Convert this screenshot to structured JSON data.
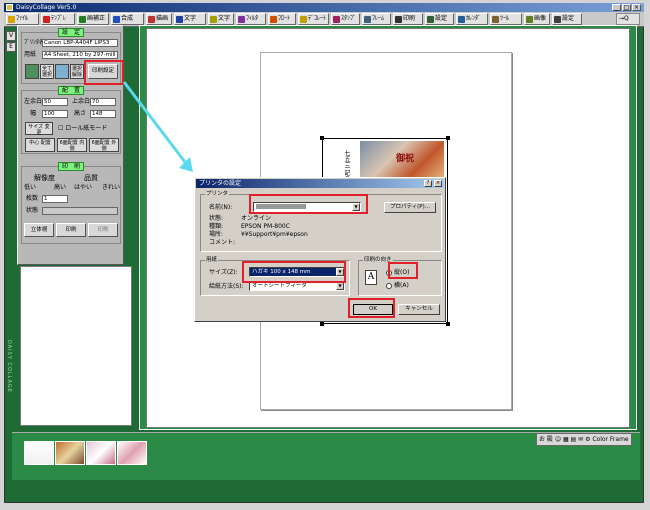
{
  "app": {
    "title": "DaisyCollage  Ver5.0"
  },
  "toolbar": {
    "items": [
      {
        "label": "ﾌｧｲﾙ",
        "icon": "folder-icon",
        "color": "#d9a400"
      },
      {
        "label": "ﾃﾝﾌﾟﾚ",
        "icon": "heart-icon",
        "color": "#d02020"
      },
      {
        "label": "画補正",
        "icon": "brush-icon",
        "color": "#208020"
      },
      {
        "label": "合成",
        "icon": "layers-icon",
        "color": "#2050c0"
      },
      {
        "label": "描画",
        "icon": "pencil-icon",
        "color": "#c03030"
      },
      {
        "label": "文字",
        "icon": "text-icon",
        "color": "#2040a0"
      },
      {
        "label": "文字",
        "icon": "text2-icon",
        "color": "#a0a000"
      },
      {
        "label": "ﾌｨﾙﾀ",
        "icon": "filter-icon",
        "color": "#8030a0"
      },
      {
        "label": "ﾌﾛｰﾄ",
        "icon": "float-icon",
        "color": "#d05000"
      },
      {
        "label": "ﾃﾞｺﾚｰﾄ",
        "icon": "decorate-icon",
        "color": "#c0a000"
      },
      {
        "label": "ｽﾀﾝﾌﾟ",
        "icon": "stamp-icon",
        "color": "#a02060"
      },
      {
        "label": "ﾌﾚｰﾑ",
        "icon": "frame-icon",
        "color": "#406080"
      },
      {
        "label": "印刷",
        "icon": "printer-icon",
        "color": "#303030"
      },
      {
        "label": "設定",
        "icon": "settings-icon",
        "color": "#306030"
      },
      {
        "label": "ｶﾚﾝﾀﾞ",
        "icon": "calendar-icon",
        "color": "#2060a0"
      },
      {
        "label": "ﾂｰﾙ",
        "icon": "tool-icon",
        "color": "#806030"
      },
      {
        "label": "画像",
        "icon": "image-icon",
        "color": "#608020"
      },
      {
        "label": "設定",
        "icon": "gear-icon",
        "color": "#404040"
      }
    ],
    "right_label": "Q"
  },
  "vtabs": [
    "V",
    "E"
  ],
  "panel": {
    "setup_head": "設　定",
    "printer_label": "ﾌﾟﾘﾝﾀ名",
    "printer_value": "Canon LBP-A404F LIPS3",
    "paper_label": "用紙",
    "paper_value": "A4 Sheet, 210 by 297-mill",
    "btn_all": "全て\n選択",
    "btn_cancel": "選択\n解除",
    "btn_print_setup": "印刷設定",
    "layout_head": "配　置",
    "left_margin_label": "左余白",
    "left_margin_value": "50",
    "top_margin_label": "上余白",
    "top_margin_value": "70",
    "width_label": "幅",
    "width_value": "100",
    "height_label": "高さ",
    "height_value": "148",
    "size_change": "サイズ\n変更",
    "roll_mode": "ロール紙モード",
    "center_place": "中心\n配置",
    "six_inside": "6面配置\n内側",
    "six_outside": "6面配置\n外側",
    "print_head": "印　刷",
    "resolution_label": "解像度",
    "quality_label": "品質",
    "res_low": "低い",
    "res_high": "高い",
    "q_fast": "はやい",
    "q_fine": "きれい",
    "copies_label": "枚数",
    "copies_value": "1",
    "status_label": "状態",
    "btn_stereo": "立体視",
    "btn_print": "印刷",
    "btn_other": "印刷"
  },
  "canvas": {
    "vtext": "七五三 記念",
    "photo_text": "御祝"
  },
  "brand": "DAISY COLLAGE",
  "tray": {
    "icons": "お 殿 ☺ ▦ ▤ ✉ ⚙ Color Frame"
  },
  "dialog": {
    "title": "プリンタの設定",
    "help": "?",
    "close": "×",
    "printer_group": "プリンタ",
    "name_label": "名前(N):",
    "name_value": "",
    "properties_btn": "プロパティ(P)...",
    "status_label": "状態:",
    "status_value": "オンライン",
    "type_label": "種類:",
    "type_value": "EPSON PM-800C",
    "where_label": "場所:",
    "where_value": "¥¥Support¥pm¥epson",
    "comment_label": "コメント:",
    "comment_value": "",
    "paper_group": "用紙",
    "size_label": "サイズ(Z):",
    "size_value": "ハガキ 100 x 148 mm",
    "source_label": "給紙方法(S):",
    "source_value": "オートシートフィーダ",
    "orientation_group": "印刷の向き",
    "orient_portrait": "縦(O)",
    "orient_landscape": "横(A)",
    "orient_icon": "A",
    "ok": "OK",
    "cancel": "キャンセル"
  },
  "colors": {
    "highlight": "#e0202a",
    "arrow": "#5ad8ee",
    "frame_green": "#1f6b36",
    "section_head": "#7ef07e"
  }
}
